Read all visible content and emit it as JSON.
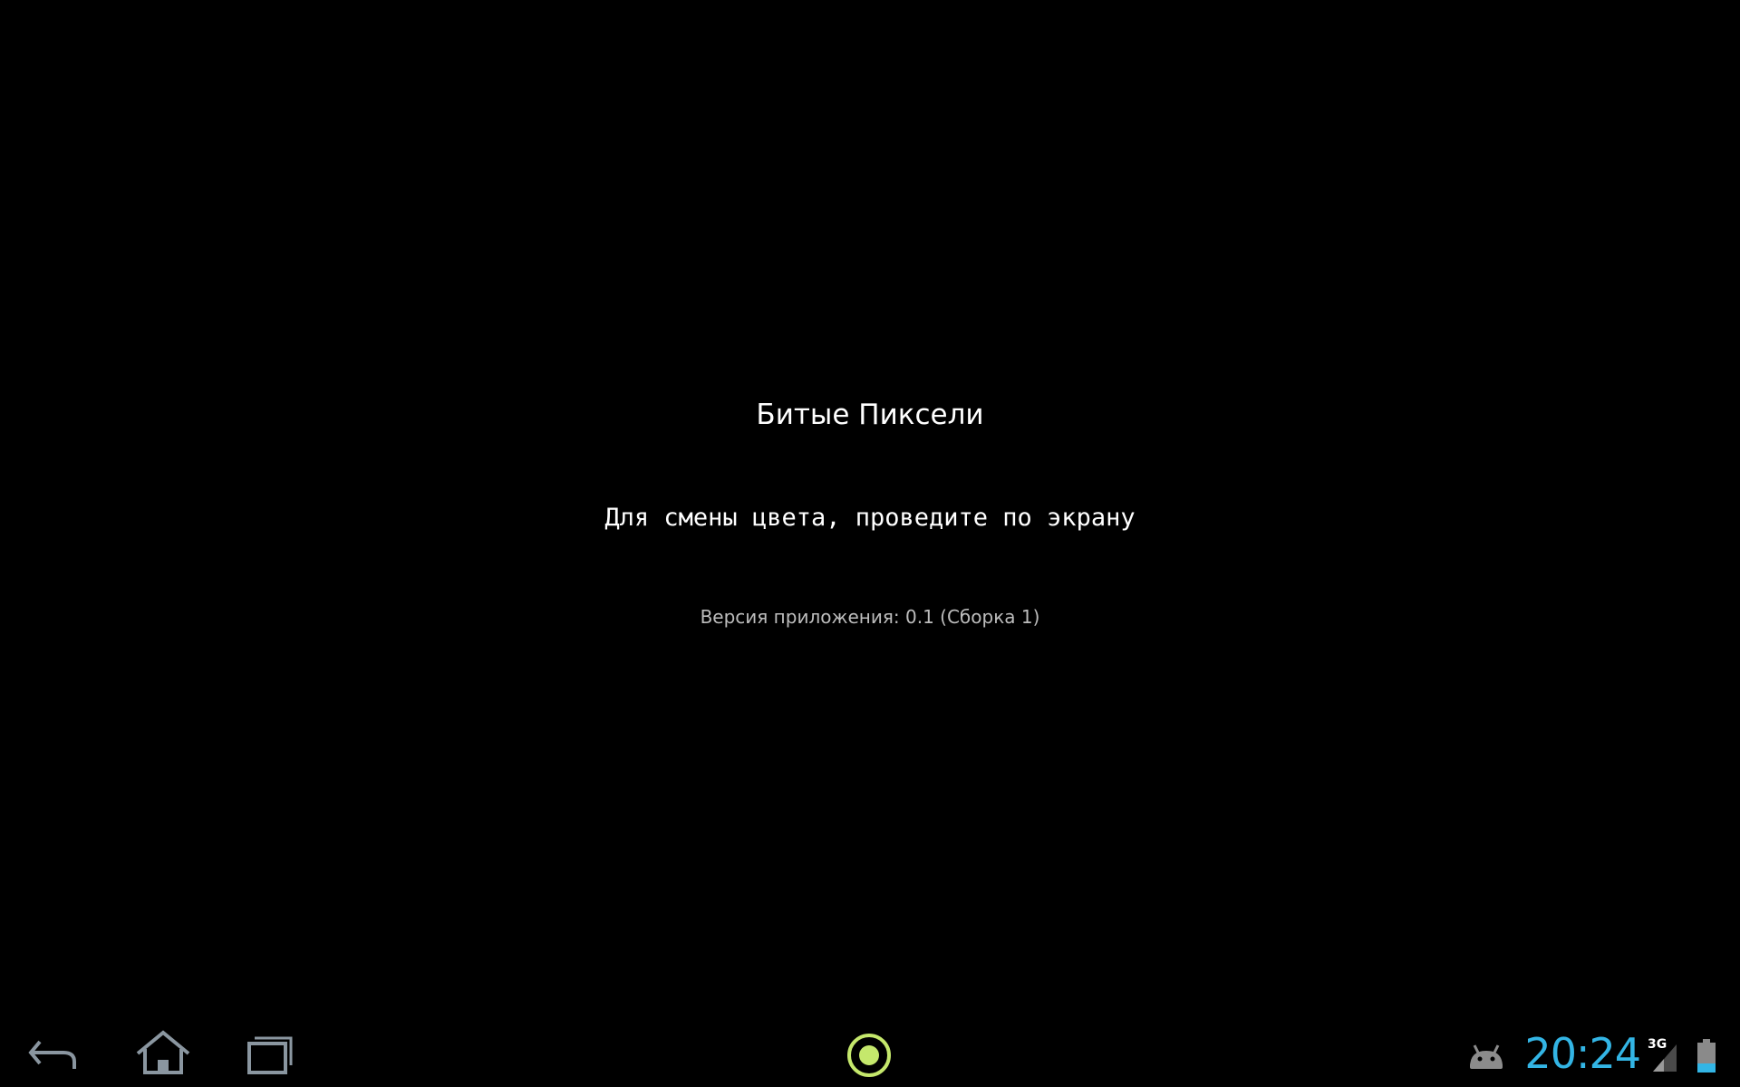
{
  "app": {
    "title": "Битые Пиксели",
    "instruction": "Для смены цвета, проведите по экрану",
    "version_text": "Версия приложения: 0.1 (Сборка 1)"
  },
  "navigation_bar": {
    "buttons": [
      {
        "name": "back",
        "icon": "back-arrow-icon"
      },
      {
        "name": "home",
        "icon": "home-icon"
      },
      {
        "name": "recent_apps",
        "icon": "recent-apps-icon"
      }
    ]
  },
  "notification": {
    "icon": "circle-target-icon",
    "color": "#c5e86c"
  },
  "status": {
    "clock": "20:24",
    "network_type": "3G",
    "signal_icon": "signal-strength-icon",
    "battery_icon": "battery-icon",
    "android_icon": "android-debug-icon",
    "accent_color": "#33b5e5",
    "nav_icon_color": "#8a96a0"
  }
}
